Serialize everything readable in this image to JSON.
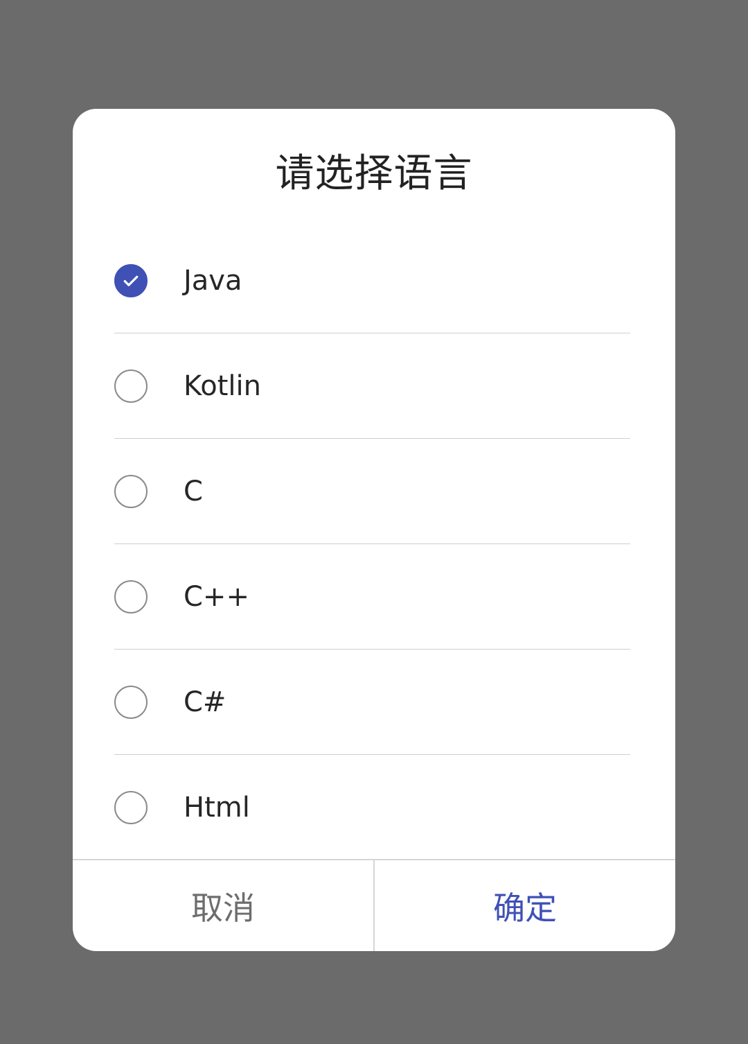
{
  "dialog": {
    "title": "请选择语言",
    "options": [
      {
        "label": "Java",
        "checked": true
      },
      {
        "label": "Kotlin",
        "checked": false
      },
      {
        "label": "C",
        "checked": false
      },
      {
        "label": "C++",
        "checked": false
      },
      {
        "label": "C#",
        "checked": false
      },
      {
        "label": "Html",
        "checked": false
      }
    ],
    "cancel_label": "取消",
    "confirm_label": "确定"
  },
  "colors": {
    "accent": "#3f51b5",
    "scrim": "#6b6b6b",
    "radio_unchecked": "#8a8a8a"
  }
}
